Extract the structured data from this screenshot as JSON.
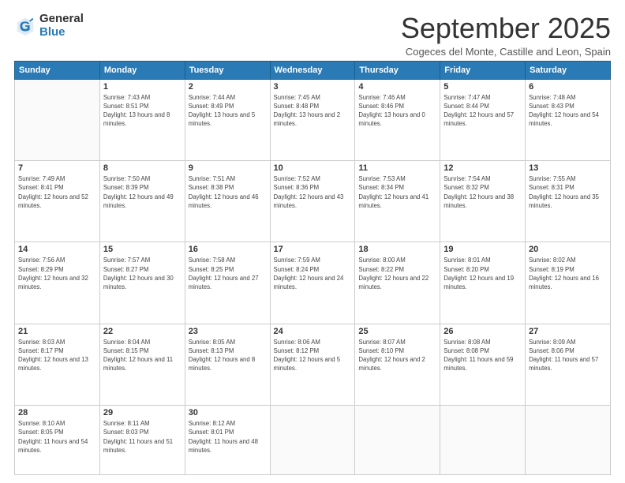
{
  "logo": {
    "general": "General",
    "blue": "Blue"
  },
  "header": {
    "month": "September 2025",
    "location": "Cogeces del Monte, Castille and Leon, Spain"
  },
  "weekdays": [
    "Sunday",
    "Monday",
    "Tuesday",
    "Wednesday",
    "Thursday",
    "Friday",
    "Saturday"
  ],
  "weeks": [
    [
      {
        "day": "",
        "sunrise": "",
        "sunset": "",
        "daylight": ""
      },
      {
        "day": "1",
        "sunrise": "Sunrise: 7:43 AM",
        "sunset": "Sunset: 8:51 PM",
        "daylight": "Daylight: 13 hours and 8 minutes."
      },
      {
        "day": "2",
        "sunrise": "Sunrise: 7:44 AM",
        "sunset": "Sunset: 8:49 PM",
        "daylight": "Daylight: 13 hours and 5 minutes."
      },
      {
        "day": "3",
        "sunrise": "Sunrise: 7:45 AM",
        "sunset": "Sunset: 8:48 PM",
        "daylight": "Daylight: 13 hours and 2 minutes."
      },
      {
        "day": "4",
        "sunrise": "Sunrise: 7:46 AM",
        "sunset": "Sunset: 8:46 PM",
        "daylight": "Daylight: 13 hours and 0 minutes."
      },
      {
        "day": "5",
        "sunrise": "Sunrise: 7:47 AM",
        "sunset": "Sunset: 8:44 PM",
        "daylight": "Daylight: 12 hours and 57 minutes."
      },
      {
        "day": "6",
        "sunrise": "Sunrise: 7:48 AM",
        "sunset": "Sunset: 8:43 PM",
        "daylight": "Daylight: 12 hours and 54 minutes."
      }
    ],
    [
      {
        "day": "7",
        "sunrise": "Sunrise: 7:49 AM",
        "sunset": "Sunset: 8:41 PM",
        "daylight": "Daylight: 12 hours and 52 minutes."
      },
      {
        "day": "8",
        "sunrise": "Sunrise: 7:50 AM",
        "sunset": "Sunset: 8:39 PM",
        "daylight": "Daylight: 12 hours and 49 minutes."
      },
      {
        "day": "9",
        "sunrise": "Sunrise: 7:51 AM",
        "sunset": "Sunset: 8:38 PM",
        "daylight": "Daylight: 12 hours and 46 minutes."
      },
      {
        "day": "10",
        "sunrise": "Sunrise: 7:52 AM",
        "sunset": "Sunset: 8:36 PM",
        "daylight": "Daylight: 12 hours and 43 minutes."
      },
      {
        "day": "11",
        "sunrise": "Sunrise: 7:53 AM",
        "sunset": "Sunset: 8:34 PM",
        "daylight": "Daylight: 12 hours and 41 minutes."
      },
      {
        "day": "12",
        "sunrise": "Sunrise: 7:54 AM",
        "sunset": "Sunset: 8:32 PM",
        "daylight": "Daylight: 12 hours and 38 minutes."
      },
      {
        "day": "13",
        "sunrise": "Sunrise: 7:55 AM",
        "sunset": "Sunset: 8:31 PM",
        "daylight": "Daylight: 12 hours and 35 minutes."
      }
    ],
    [
      {
        "day": "14",
        "sunrise": "Sunrise: 7:56 AM",
        "sunset": "Sunset: 8:29 PM",
        "daylight": "Daylight: 12 hours and 32 minutes."
      },
      {
        "day": "15",
        "sunrise": "Sunrise: 7:57 AM",
        "sunset": "Sunset: 8:27 PM",
        "daylight": "Daylight: 12 hours and 30 minutes."
      },
      {
        "day": "16",
        "sunrise": "Sunrise: 7:58 AM",
        "sunset": "Sunset: 8:25 PM",
        "daylight": "Daylight: 12 hours and 27 minutes."
      },
      {
        "day": "17",
        "sunrise": "Sunrise: 7:59 AM",
        "sunset": "Sunset: 8:24 PM",
        "daylight": "Daylight: 12 hours and 24 minutes."
      },
      {
        "day": "18",
        "sunrise": "Sunrise: 8:00 AM",
        "sunset": "Sunset: 8:22 PM",
        "daylight": "Daylight: 12 hours and 22 minutes."
      },
      {
        "day": "19",
        "sunrise": "Sunrise: 8:01 AM",
        "sunset": "Sunset: 8:20 PM",
        "daylight": "Daylight: 12 hours and 19 minutes."
      },
      {
        "day": "20",
        "sunrise": "Sunrise: 8:02 AM",
        "sunset": "Sunset: 8:19 PM",
        "daylight": "Daylight: 12 hours and 16 minutes."
      }
    ],
    [
      {
        "day": "21",
        "sunrise": "Sunrise: 8:03 AM",
        "sunset": "Sunset: 8:17 PM",
        "daylight": "Daylight: 12 hours and 13 minutes."
      },
      {
        "day": "22",
        "sunrise": "Sunrise: 8:04 AM",
        "sunset": "Sunset: 8:15 PM",
        "daylight": "Daylight: 12 hours and 11 minutes."
      },
      {
        "day": "23",
        "sunrise": "Sunrise: 8:05 AM",
        "sunset": "Sunset: 8:13 PM",
        "daylight": "Daylight: 12 hours and 8 minutes."
      },
      {
        "day": "24",
        "sunrise": "Sunrise: 8:06 AM",
        "sunset": "Sunset: 8:12 PM",
        "daylight": "Daylight: 12 hours and 5 minutes."
      },
      {
        "day": "25",
        "sunrise": "Sunrise: 8:07 AM",
        "sunset": "Sunset: 8:10 PM",
        "daylight": "Daylight: 12 hours and 2 minutes."
      },
      {
        "day": "26",
        "sunrise": "Sunrise: 8:08 AM",
        "sunset": "Sunset: 8:08 PM",
        "daylight": "Daylight: 11 hours and 59 minutes."
      },
      {
        "day": "27",
        "sunrise": "Sunrise: 8:09 AM",
        "sunset": "Sunset: 8:06 PM",
        "daylight": "Daylight: 11 hours and 57 minutes."
      }
    ],
    [
      {
        "day": "28",
        "sunrise": "Sunrise: 8:10 AM",
        "sunset": "Sunset: 8:05 PM",
        "daylight": "Daylight: 11 hours and 54 minutes."
      },
      {
        "day": "29",
        "sunrise": "Sunrise: 8:11 AM",
        "sunset": "Sunset: 8:03 PM",
        "daylight": "Daylight: 11 hours and 51 minutes."
      },
      {
        "day": "30",
        "sunrise": "Sunrise: 8:12 AM",
        "sunset": "Sunset: 8:01 PM",
        "daylight": "Daylight: 11 hours and 48 minutes."
      },
      {
        "day": "",
        "sunrise": "",
        "sunset": "",
        "daylight": ""
      },
      {
        "day": "",
        "sunrise": "",
        "sunset": "",
        "daylight": ""
      },
      {
        "day": "",
        "sunrise": "",
        "sunset": "",
        "daylight": ""
      },
      {
        "day": "",
        "sunrise": "",
        "sunset": "",
        "daylight": ""
      }
    ]
  ]
}
